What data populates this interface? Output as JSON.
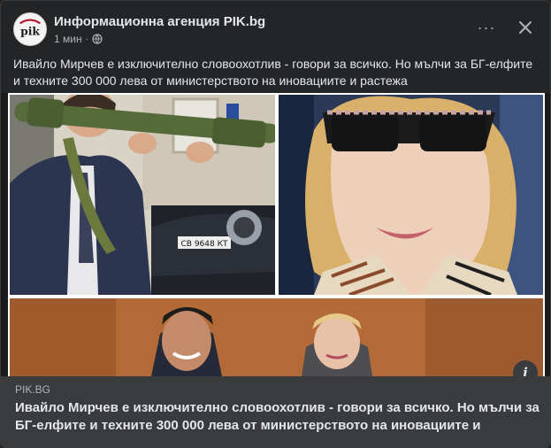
{
  "post": {
    "page_name": "Информационна агенция PIK.bg",
    "time": "1 мин",
    "separator": "·",
    "privacy_icon": "globe-icon",
    "more_icon": "more-options-icon",
    "more_label": "···",
    "close_icon": "close-icon",
    "text": "Ивайло Мирчев е изключително словоохотлив - говори за всичко. Но мълчи за БГ-елфите и техните 300 000 лева от министерството на иновациите и растежа"
  },
  "media": {
    "info_icon": "info-icon",
    "info_label": "i",
    "license_plate": "СВ 9648 КТ"
  },
  "link": {
    "domain": "PIK.BG",
    "title": "Ивайло Мирчев е изключително словоохотлив - говори за всичко. Но мълчи за БГ-елфите и техните 300 000 лева от министерството на иновациите и"
  },
  "colors": {
    "card_bg": "#242526",
    "link_bg": "#3a3b3c",
    "text_primary": "#e4e6eb",
    "text_secondary": "#b0b3b8"
  }
}
